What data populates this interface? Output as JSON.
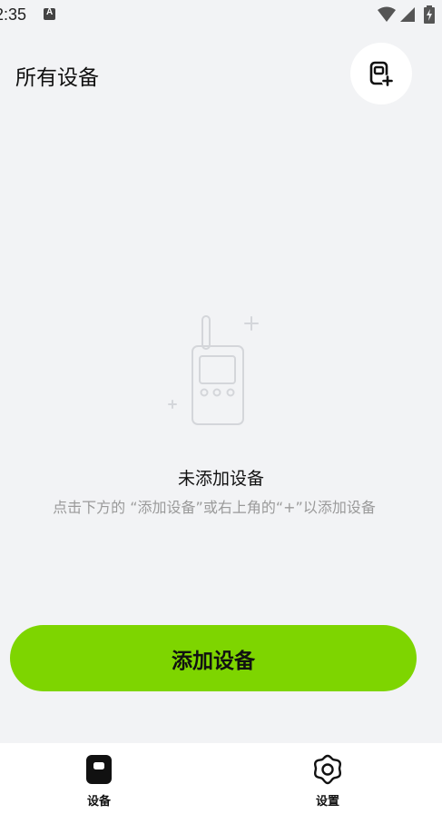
{
  "status_bar": {
    "time": "2:35",
    "notification_glyph": "A"
  },
  "header": {
    "title": "所有设备"
  },
  "empty_state": {
    "title": "未添加设备",
    "hint": "点击下方的 “添加设备”或右上角的“+”以添加设备"
  },
  "actions": {
    "add_device_label": "添加设备"
  },
  "bottom_nav": {
    "items": [
      {
        "label": "设备",
        "icon": "device-icon",
        "active": true
      },
      {
        "label": "设置",
        "icon": "settings-gear-icon",
        "active": false
      }
    ]
  },
  "colors": {
    "accent": "#7ed500",
    "background": "#f2f3f5",
    "muted_text": "#9a9a9a",
    "illustration": "#d4d6da"
  }
}
